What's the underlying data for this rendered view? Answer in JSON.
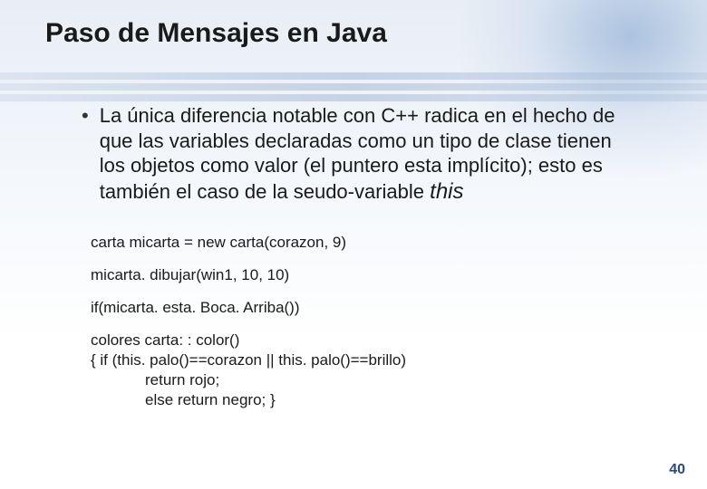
{
  "title": "Paso de Mensajes en Java",
  "bullet": {
    "marker": "•",
    "text_part1": "La única diferencia notable con C++ radica en el hecho de que las variables declaradas como un tipo de clase tienen los objetos como valor (el puntero esta implícito); esto es también el caso de la seudo-variable ",
    "text_this": "this"
  },
  "code": {
    "l1": "carta micarta = new carta(corazon, 9)",
    "l2": "micarta. dibujar(win1, 10, 10)",
    "l3": "if(micarta. esta. Boca. Arriba())",
    "l4a": "colores carta: : color()",
    "l4b": "{    if (this. palo()==corazon || this. palo()==brillo)",
    "l4c": "return rojo;",
    "l4d": "else return negro;  }"
  },
  "page_number": "40"
}
